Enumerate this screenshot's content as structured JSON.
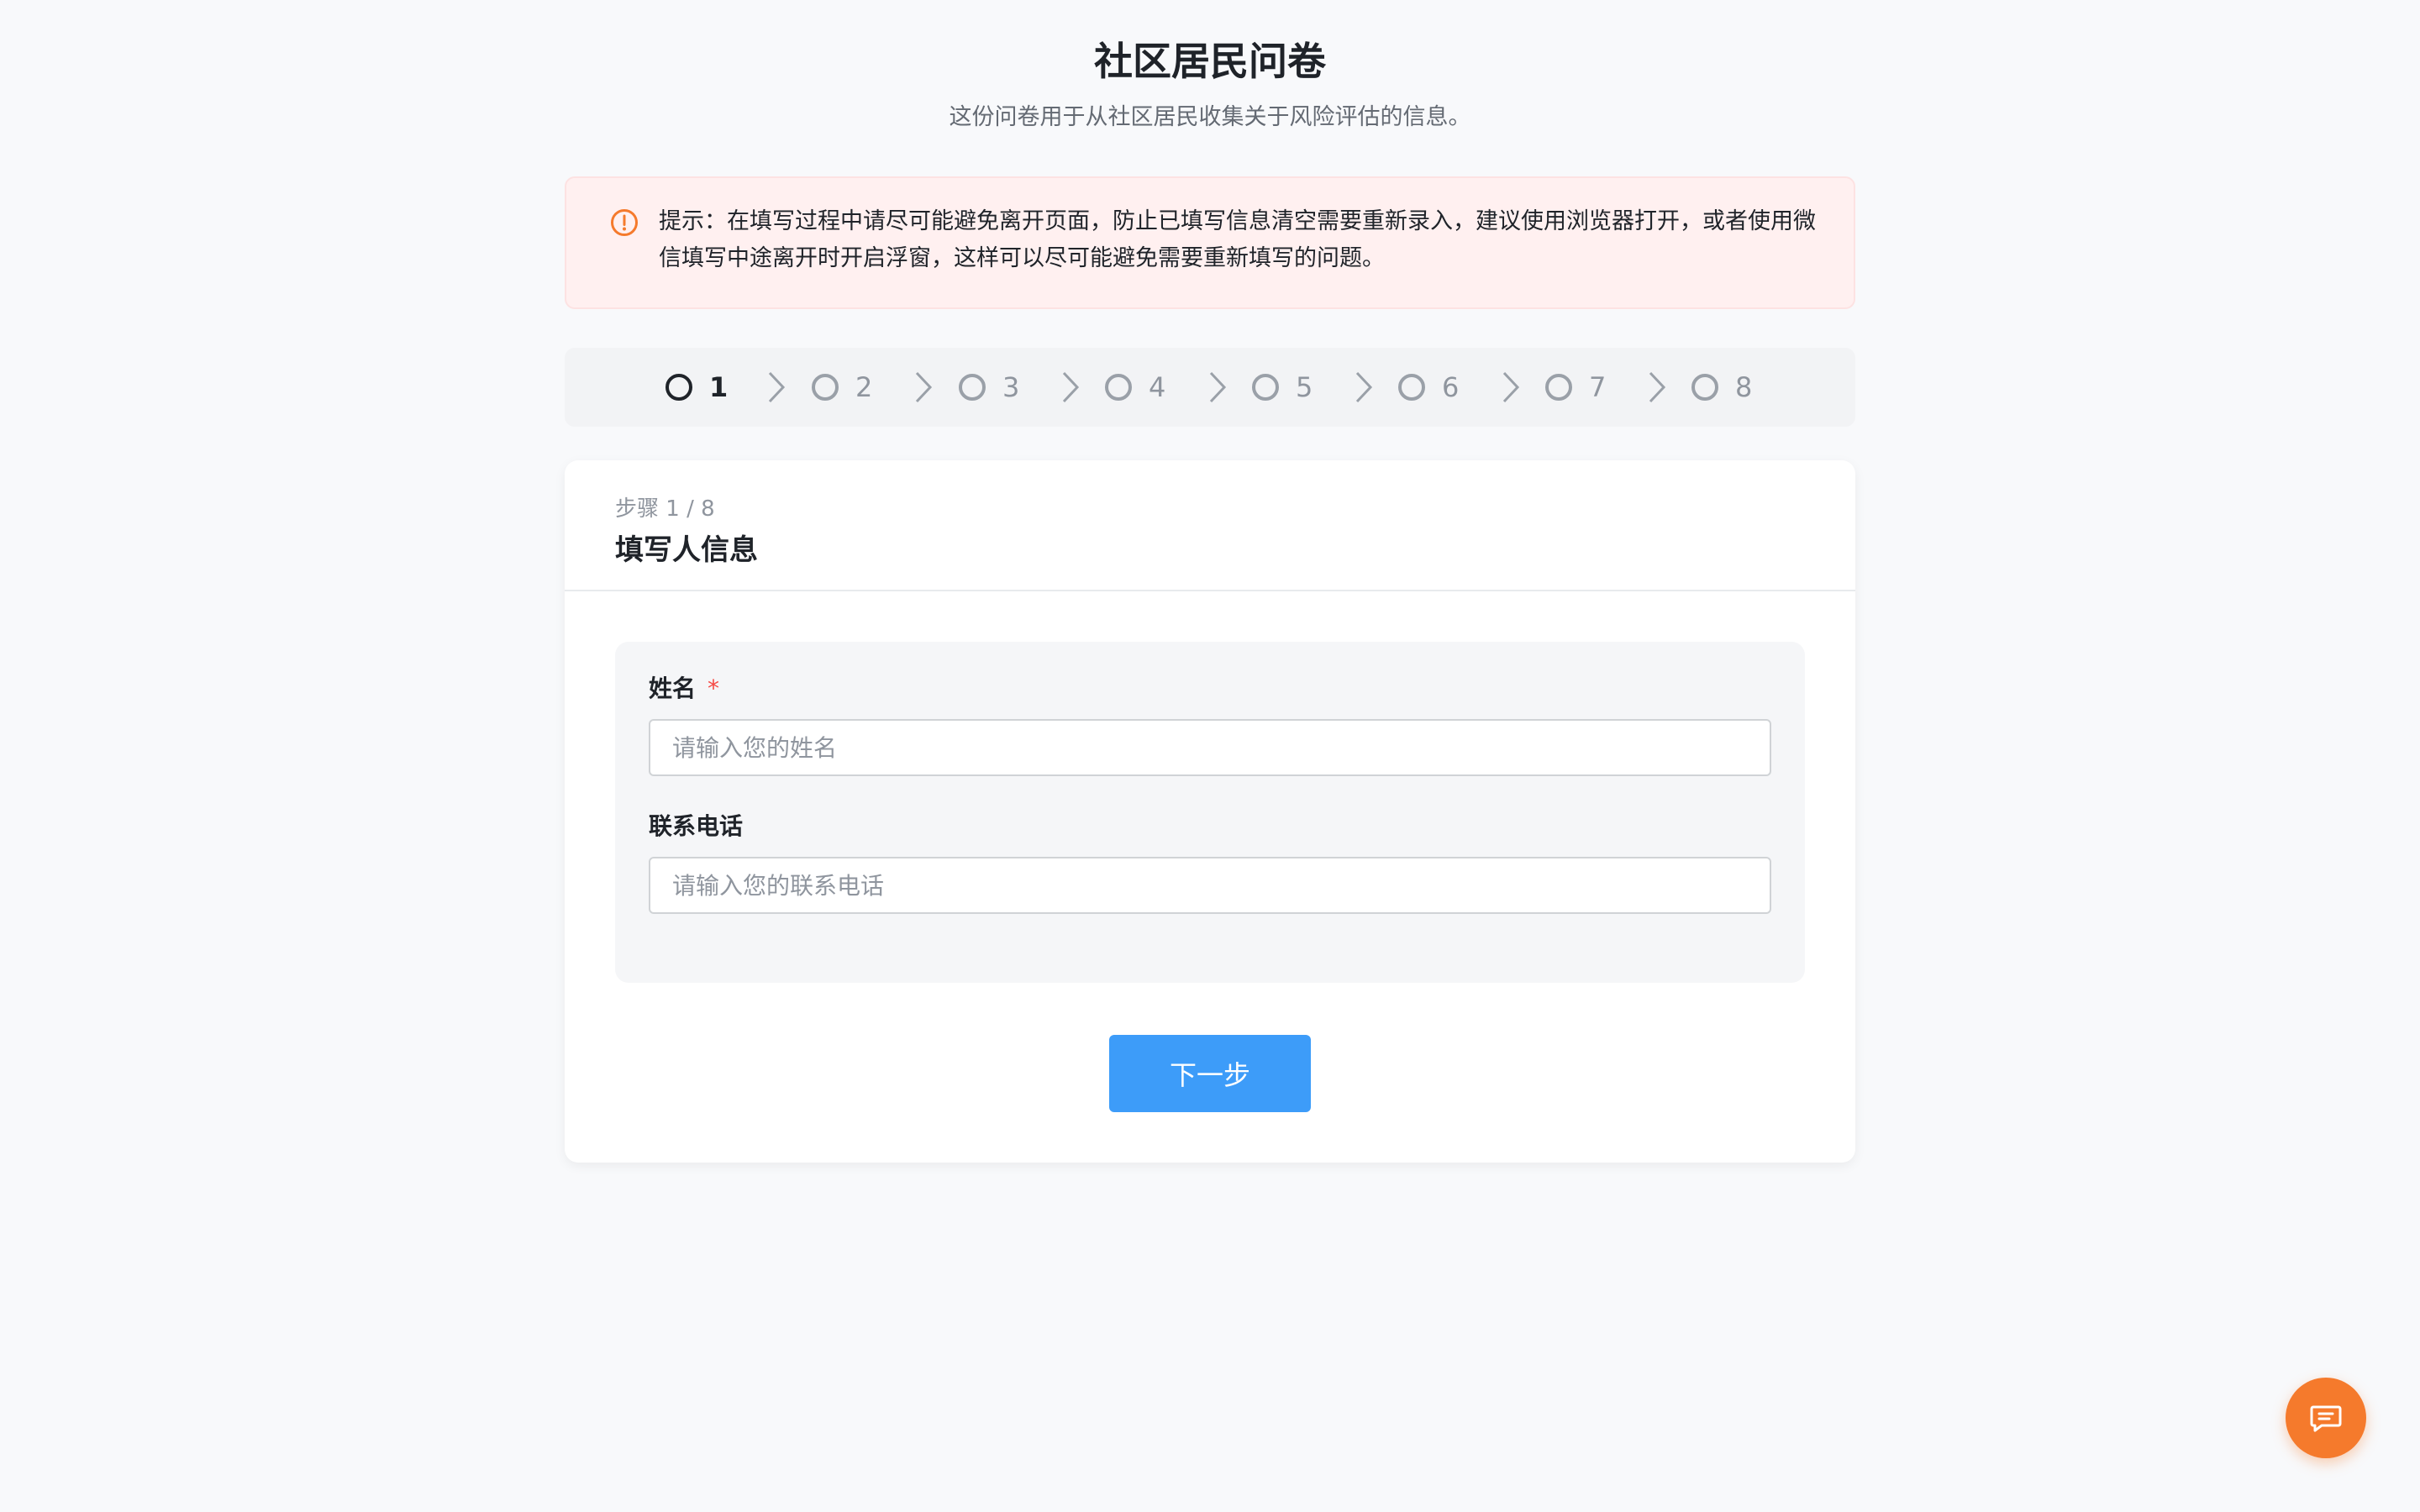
{
  "header": {
    "title": "社区居民问卷",
    "subtitle": "这份问卷用于从社区居民收集关于风险评估的信息。"
  },
  "notice": {
    "icon": "alert-circle-icon",
    "text": "提示：在填写过程中请尽可能避免离开页面，防止已填写信息清空需要重新录入，建议使用浏览器打开，或者使用微信填写中途离开时开启浮窗，这样可以尽可能避免需要重新填写的问题。",
    "color": "#f57a2c"
  },
  "steps": {
    "items": [
      {
        "label": "1",
        "active": true
      },
      {
        "label": "2",
        "active": false
      },
      {
        "label": "3",
        "active": false
      },
      {
        "label": "4",
        "active": false
      },
      {
        "label": "5",
        "active": false
      },
      {
        "label": "6",
        "active": false
      },
      {
        "label": "7",
        "active": false
      },
      {
        "label": "8",
        "active": false
      }
    ]
  },
  "card": {
    "step_indicator": "步骤 1 / 8",
    "section_title": "填写人信息"
  },
  "form": {
    "name": {
      "label": "姓名",
      "required_mark": "*",
      "placeholder": "请输入您的姓名",
      "value": ""
    },
    "phone": {
      "label": "联系电话",
      "placeholder": "请输入您的联系电话",
      "value": ""
    }
  },
  "actions": {
    "next_label": "下一步"
  },
  "colors": {
    "primary": "#3d9cf9",
    "accent": "#f57a2c",
    "required": "#f54a45"
  }
}
